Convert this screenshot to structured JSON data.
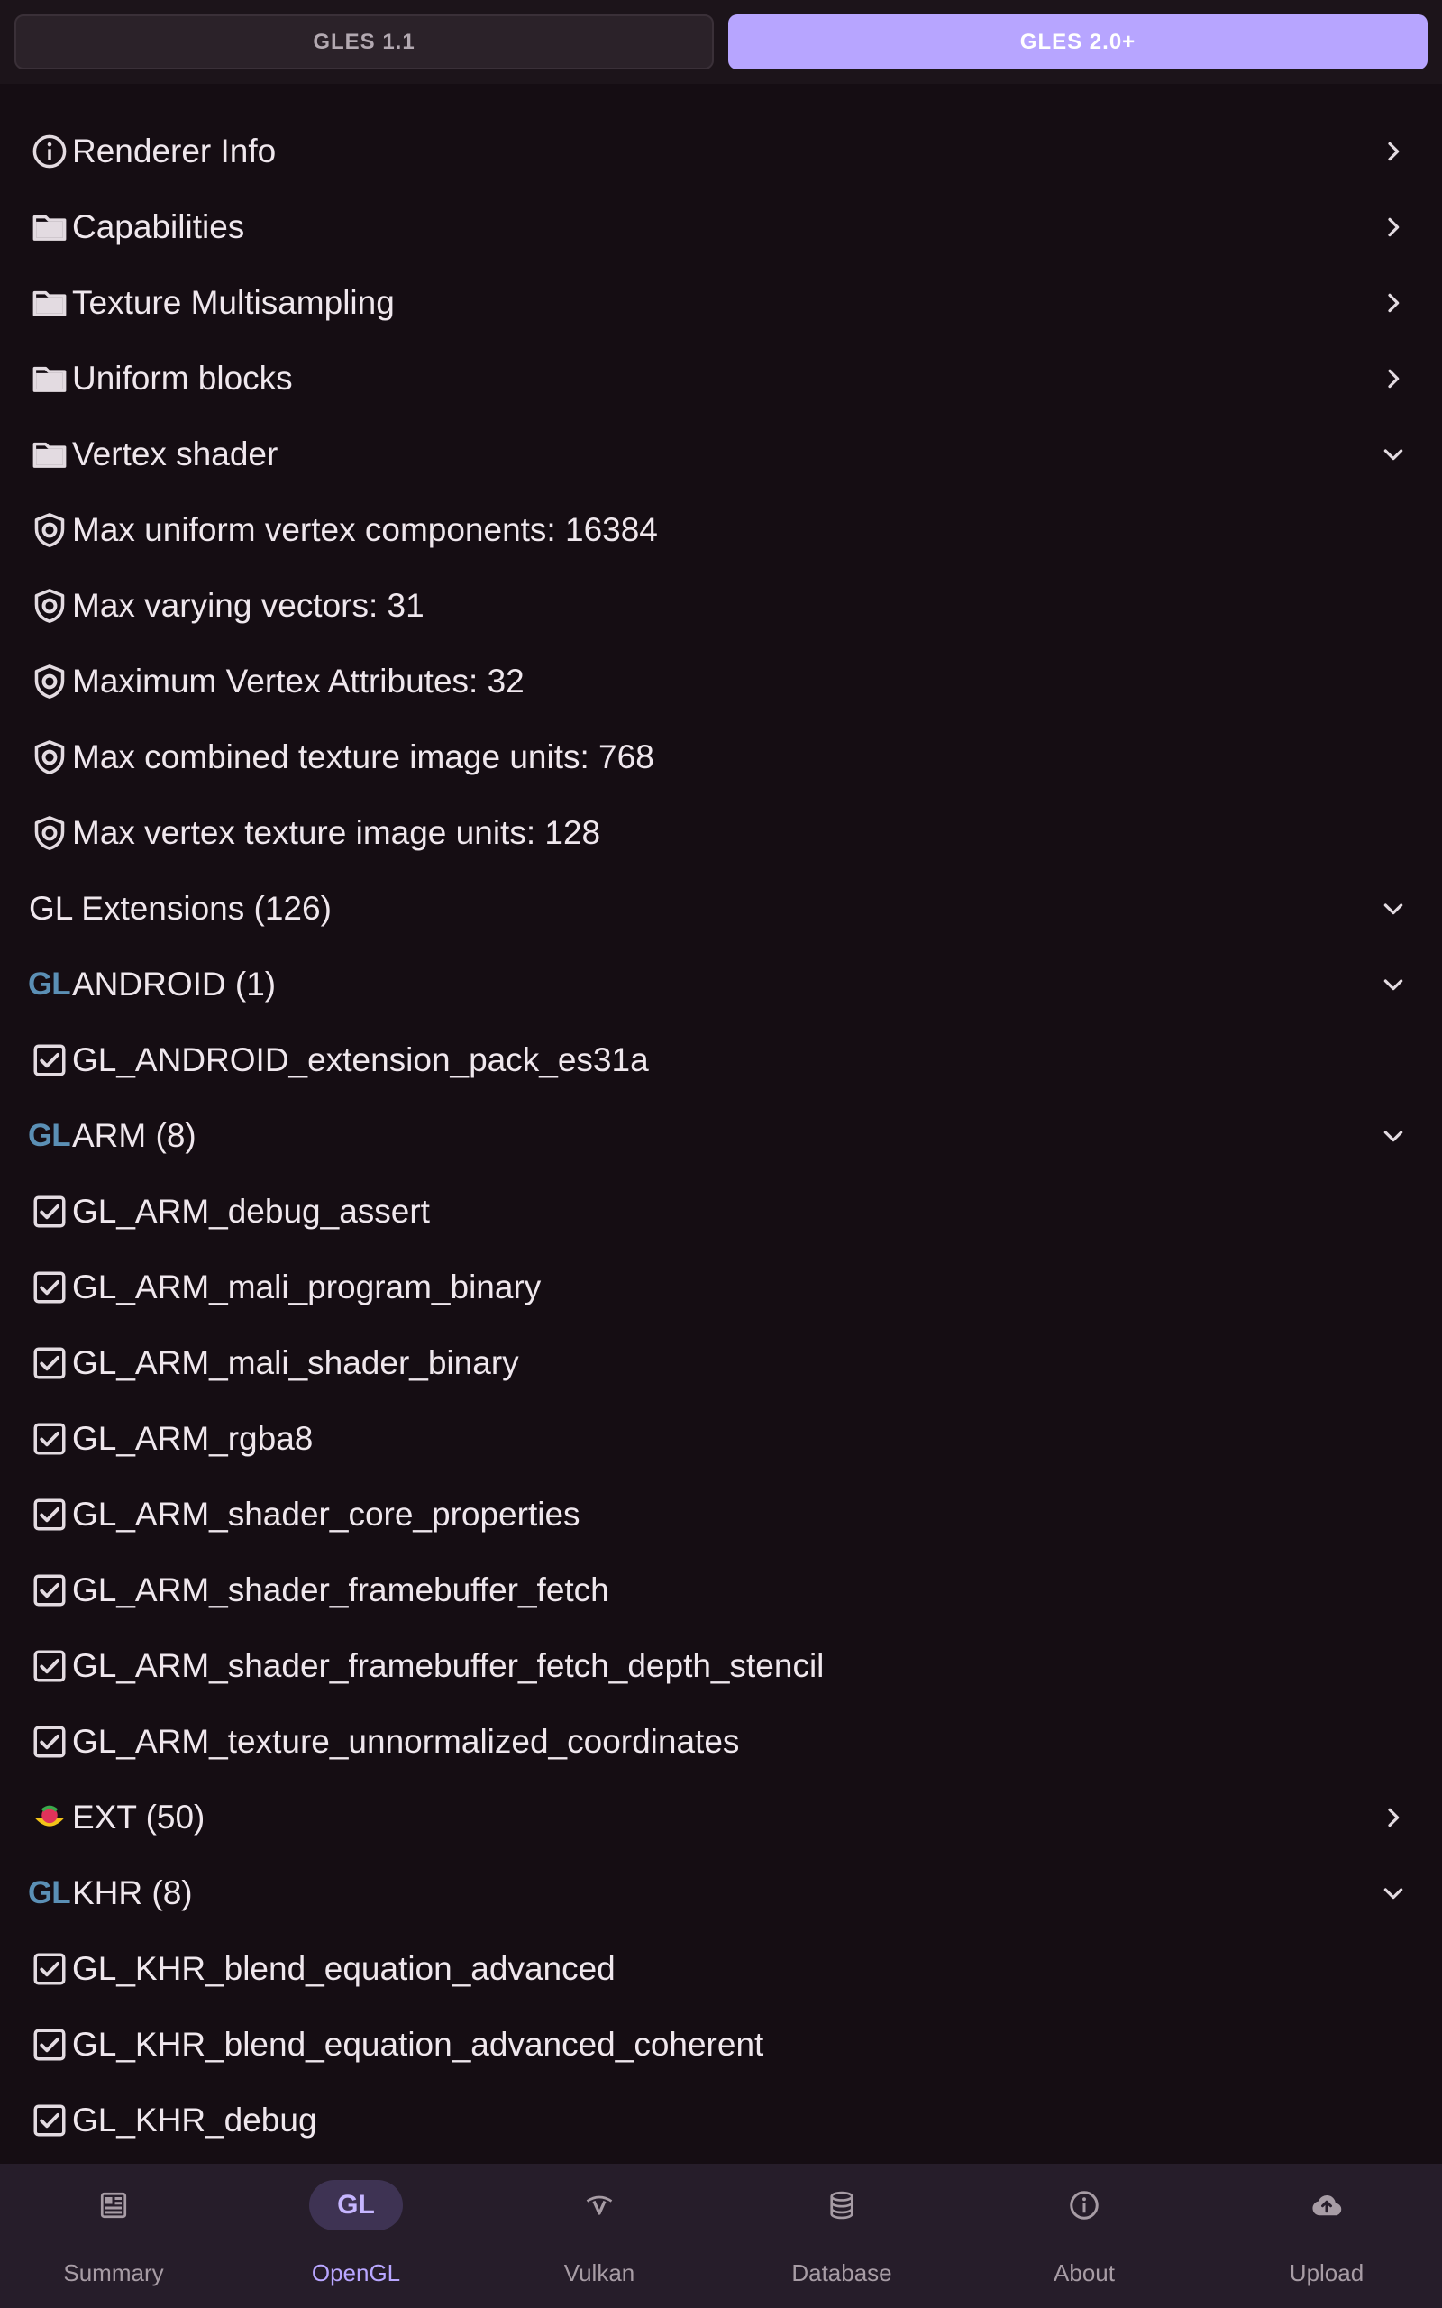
{
  "segments": {
    "left_label": "GLES 1.1",
    "right_label": "GLES 2.0+",
    "selected": "GLES 2.0+"
  },
  "rows": [
    {
      "icon": "info-icon",
      "label": "Renderer Info",
      "trailing": "chevron-right"
    },
    {
      "icon": "folder-icon",
      "label": "Capabilities",
      "trailing": "chevron-right"
    },
    {
      "icon": "folder-icon",
      "label": "Texture Multisampling",
      "trailing": "chevron-right"
    },
    {
      "icon": "folder-icon",
      "label": "Uniform blocks",
      "trailing": "chevron-right"
    },
    {
      "icon": "folder-icon",
      "label": "Vertex shader",
      "trailing": "chevron-down"
    },
    {
      "icon": "shield-icon",
      "label": "Max uniform vertex components: 16384"
    },
    {
      "icon": "shield-icon",
      "label": "Max varying vectors: 31"
    },
    {
      "icon": "shield-icon",
      "label": "Maximum Vertex Attributes: 32"
    },
    {
      "icon": "shield-icon",
      "label": "Max combined texture image units: 768"
    },
    {
      "icon": "shield-icon",
      "label": "Max vertex texture image units: 128"
    },
    {
      "icon": "",
      "label": "GL Extensions (126)",
      "trailing": "chevron-down"
    },
    {
      "icon": "gl-logo",
      "icon_text": "GL",
      "label": "ANDROID (1)",
      "trailing": "chevron-down"
    },
    {
      "icon": "checkbox-icon",
      "label": "GL_ANDROID_extension_pack_es31a"
    },
    {
      "icon": "gl-logo",
      "icon_text": "GL",
      "label": "ARM (8)",
      "trailing": "chevron-down"
    },
    {
      "icon": "checkbox-icon",
      "label": "GL_ARM_debug_assert"
    },
    {
      "icon": "checkbox-icon",
      "label": "GL_ARM_mali_program_binary"
    },
    {
      "icon": "checkbox-icon",
      "label": "GL_ARM_mali_shader_binary"
    },
    {
      "icon": "checkbox-icon",
      "label": "GL_ARM_rgba8"
    },
    {
      "icon": "checkbox-icon",
      "label": "GL_ARM_shader_core_properties"
    },
    {
      "icon": "checkbox-icon",
      "label": "GL_ARM_shader_framebuffer_fetch"
    },
    {
      "icon": "checkbox-icon",
      "label": "GL_ARM_shader_framebuffer_fetch_depth_stencil"
    },
    {
      "icon": "checkbox-icon",
      "label": "GL_ARM_texture_unnormalized_coordinates"
    },
    {
      "icon": "ext-logo-icon",
      "label": "EXT (50)",
      "trailing": "chevron-right"
    },
    {
      "icon": "gl-logo",
      "icon_text": "GL",
      "label": "KHR (8)",
      "trailing": "chevron-down"
    },
    {
      "icon": "checkbox-icon",
      "label": "GL_KHR_blend_equation_advanced"
    },
    {
      "icon": "checkbox-icon",
      "label": "GL_KHR_blend_equation_advanced_coherent"
    },
    {
      "icon": "checkbox-icon",
      "label": "GL_KHR_debug"
    }
  ],
  "bottom_nav": [
    {
      "label": "Summary",
      "icon": "summary-icon",
      "selected": false
    },
    {
      "label": "OpenGL",
      "icon": "gl-logo",
      "icon_text": "GL",
      "selected": true
    },
    {
      "label": "Vulkan",
      "icon": "vulkan-icon",
      "selected": false
    },
    {
      "label": "Database",
      "icon": "database-icon",
      "selected": false
    },
    {
      "label": "About",
      "icon": "info-icon",
      "selected": false
    },
    {
      "label": "Upload",
      "icon": "cloud-upload-icon",
      "selected": false
    }
  ],
  "colors": {
    "background": "#150d13",
    "accent": "#b7a5ff",
    "gl_logo": "#5b8fb5",
    "nav_background": "#261d2a"
  }
}
